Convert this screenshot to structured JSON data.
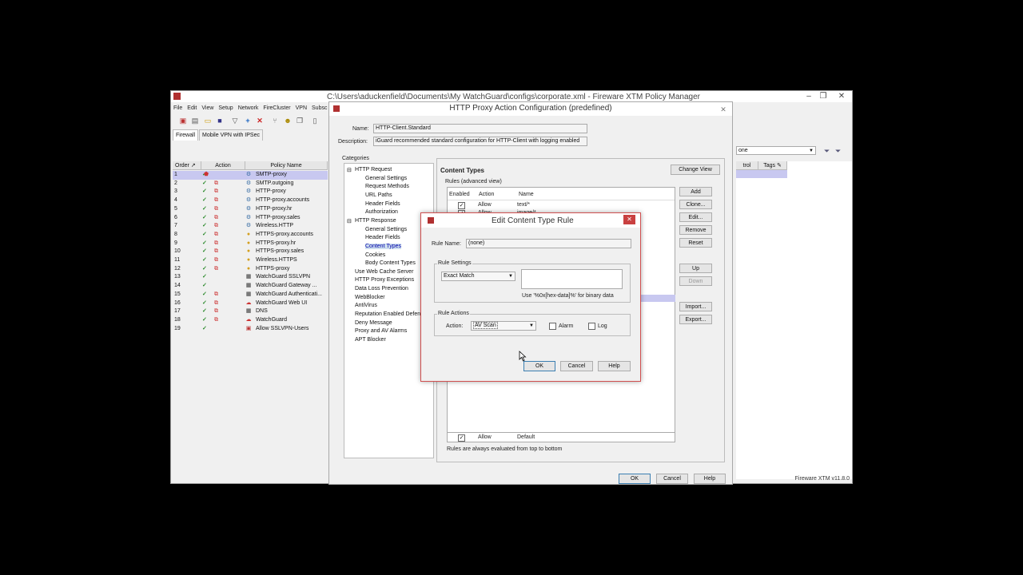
{
  "main_window": {
    "title": "C:\\Users\\aduckenfield\\Documents\\My WatchGuard\\configs\\corporate.xml - Fireware XTM Policy Manager",
    "menu": [
      "File",
      "Edit",
      "View",
      "Setup",
      "Network",
      "FireCluster",
      "VPN",
      "Subsc"
    ],
    "tabs": [
      "Firewall",
      "Mobile VPN with IPSec"
    ],
    "columns": {
      "order": "Order",
      "action": "Action",
      "policy_name": "Policy Name",
      "control": "trol",
      "tags": "Tags"
    },
    "filter_value": "one",
    "status": "Fireware XTM v11.8.0",
    "policies": [
      {
        "order": "1",
        "name": "SMTP-proxy",
        "icon": "proxy-icon",
        "selected": true
      },
      {
        "order": "2",
        "name": "SMTP.outgoing",
        "icon": "proxy-icon"
      },
      {
        "order": "3",
        "name": "HTTP-proxy",
        "icon": "proxy-icon"
      },
      {
        "order": "4",
        "name": "HTTP-proxy.accounts",
        "icon": "proxy-icon"
      },
      {
        "order": "5",
        "name": "HTTP-proxy.hr",
        "icon": "proxy-icon"
      },
      {
        "order": "6",
        "name": "HTTP-proxy.sales",
        "icon": "proxy-icon"
      },
      {
        "order": "7",
        "name": "Wireless.HTTP",
        "icon": "proxy-icon"
      },
      {
        "order": "8",
        "name": "HTTPS-proxy.accounts",
        "icon": "lock-icon"
      },
      {
        "order": "9",
        "name": "HTTPS-proxy.hr",
        "icon": "lock-icon"
      },
      {
        "order": "10",
        "name": "HTTPS-proxy.sales",
        "icon": "lock-icon"
      },
      {
        "order": "11",
        "name": "Wireless.HTTPS",
        "icon": "lock-icon"
      },
      {
        "order": "12",
        "name": "HTTPS-proxy",
        "icon": "lock-icon"
      },
      {
        "order": "13",
        "name": "WatchGuard SSLVPN",
        "icon": "grid-icon"
      },
      {
        "order": "14",
        "name": "WatchGuard Gateway ...",
        "icon": "grid-icon"
      },
      {
        "order": "15",
        "name": "WatchGuard Authenticati...",
        "icon": "grid-icon"
      },
      {
        "order": "16",
        "name": "WatchGuard Web UI",
        "icon": "cloud-icon"
      },
      {
        "order": "17",
        "name": "DNS",
        "icon": "grid-icon"
      },
      {
        "order": "18",
        "name": "WatchGuard",
        "icon": "cloud-icon"
      },
      {
        "order": "19",
        "name": "Allow SSLVPN-Users",
        "icon": "user-icon"
      }
    ]
  },
  "proxy_dialog": {
    "title": "HTTP Proxy Action Configuration (predefined)",
    "name_label": "Name:",
    "name_value": "HTTP-Client.Standard",
    "desc_label": "Description:",
    "desc_value": "iGuard recommended standard configuration for HTTP-Client with logging enabled",
    "categories_label": "Categories",
    "tree": [
      {
        "label": "HTTP Request",
        "level": 0,
        "expander": "⊟"
      },
      {
        "label": "General Settings",
        "level": 1
      },
      {
        "label": "Request Methods",
        "level": 1
      },
      {
        "label": "URL Paths",
        "level": 1
      },
      {
        "label": "Header Fields",
        "level": 1
      },
      {
        "label": "Authorization",
        "level": 1
      },
      {
        "label": "HTTP Response",
        "level": 0,
        "expander": "⊟"
      },
      {
        "label": "General Settings",
        "level": 1
      },
      {
        "label": "Header Fields",
        "level": 1
      },
      {
        "label": "Content Types",
        "level": 1,
        "selected": true
      },
      {
        "label": "Cookies",
        "level": 1
      },
      {
        "label": "Body Content Types",
        "level": 1
      },
      {
        "label": "Use Web Cache Server",
        "level": 0
      },
      {
        "label": "HTTP Proxy Exceptions",
        "level": 0
      },
      {
        "label": "Data Loss Prevention",
        "level": 0
      },
      {
        "label": "WebBlocker",
        "level": 0
      },
      {
        "label": "AntiVirus",
        "level": 0
      },
      {
        "label": "Reputation Enabled Defen",
        "level": 0
      },
      {
        "label": "Deny Message",
        "level": 0
      },
      {
        "label": "Proxy and AV Alarms",
        "level": 0
      },
      {
        "label": "APT Blocker",
        "level": 0
      }
    ],
    "section_title": "Content Types",
    "change_view": "Change View",
    "rules_label": "Rules (advanced view)",
    "rules_headers": [
      "Enabled",
      "Action",
      "Name"
    ],
    "rules": [
      {
        "action": "Allow",
        "name": "text/*"
      },
      {
        "action": "Allow",
        "name": "image/*"
      }
    ],
    "default_rule": {
      "action": "Allow",
      "name": "Default"
    },
    "footnote": "Rules are always evaluated from top to bottom",
    "side_buttons": [
      "Add",
      "Clone...",
      "Edit...",
      "Remove",
      "Reset",
      "Up",
      "Down",
      "Import...",
      "Export..."
    ],
    "ok": "OK",
    "cancel": "Cancel",
    "help": "Help"
  },
  "edit_dialog": {
    "title": "Edit Content Type Rule",
    "rule_name_label": "Rule Name:",
    "rule_name_value": "(none)",
    "rule_settings_label": "Rule Settings",
    "match_type": "Exact Match",
    "hint": "Use '%0x[hex-data]%' for binary data",
    "rule_actions_label": "Rule Actions",
    "action_label": "Action:",
    "action_value": "AV Scan",
    "alarm_label": "Alarm",
    "log_label": "Log",
    "ok": "OK",
    "cancel": "Cancel",
    "help": "Help"
  }
}
